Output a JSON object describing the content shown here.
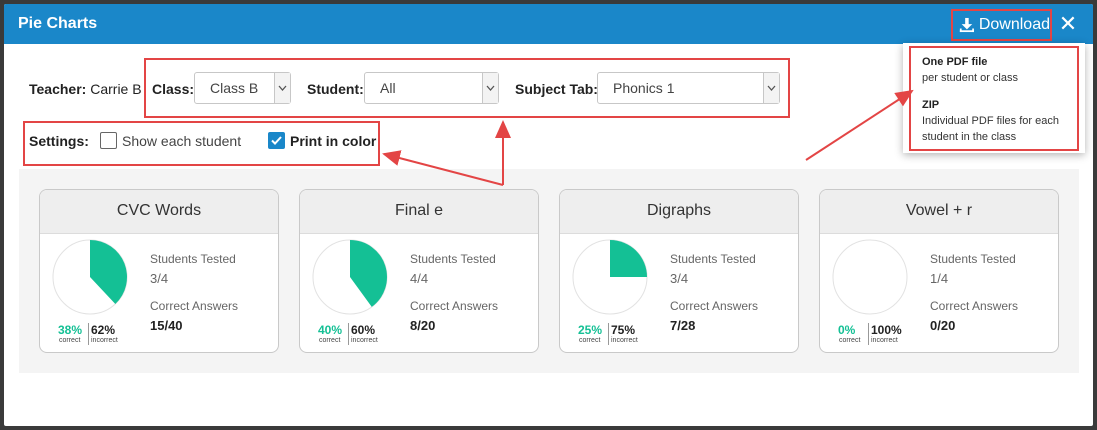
{
  "window": {
    "title": "Pie Charts",
    "download_label": "Download",
    "close_label": "✕"
  },
  "filters": {
    "teacher_label": "Teacher:",
    "teacher_value": "Carrie B",
    "class_label": "Class:",
    "class_value": "Class B",
    "student_label": "Student:",
    "student_value": "All",
    "subject_label": "Subject Tab:",
    "subject_value": "Phonics 1"
  },
  "settings": {
    "label": "Settings:",
    "show_each_student": {
      "label": "Show each student",
      "checked": false
    },
    "print_in_color": {
      "label": "Print in color",
      "checked": true
    }
  },
  "download_menu": {
    "pdf_title": "One PDF file",
    "pdf_desc": "per student or class",
    "zip_title": "ZIP",
    "zip_desc_1": "Individual PDF files for each",
    "zip_desc_2": "student in the class"
  },
  "cards": [
    {
      "title": "CVC Words",
      "students_label": "Students Tested",
      "students_value": "3/4",
      "answers_label": "Correct Answers",
      "answers_value": "15/40",
      "correct_pct": "38%",
      "incorrect_pct": "62%",
      "correct_fraction": 0.38
    },
    {
      "title": "Final e",
      "students_label": "Students Tested",
      "students_value": "4/4",
      "answers_label": "Correct Answers",
      "answers_value": "8/20",
      "correct_pct": "40%",
      "incorrect_pct": "60%",
      "correct_fraction": 0.4
    },
    {
      "title": "Digraphs",
      "students_label": "Students Tested",
      "students_value": "3/4",
      "answers_label": "Correct Answers",
      "answers_value": "7/28",
      "correct_pct": "25%",
      "incorrect_pct": "75%",
      "correct_fraction": 0.25
    },
    {
      "title": "Vowel + r",
      "students_label": "Students Tested",
      "students_value": "1/4",
      "answers_label": "Correct Answers",
      "answers_value": "0/20",
      "correct_pct": "0%",
      "incorrect_pct": "100%",
      "correct_fraction": 0.0
    }
  ],
  "legend": {
    "correct": "correct",
    "incorrect": "incorrect"
  },
  "colors": {
    "accent": "#1a87c9",
    "correct": "#14c095",
    "annotation": "#e34545"
  }
}
